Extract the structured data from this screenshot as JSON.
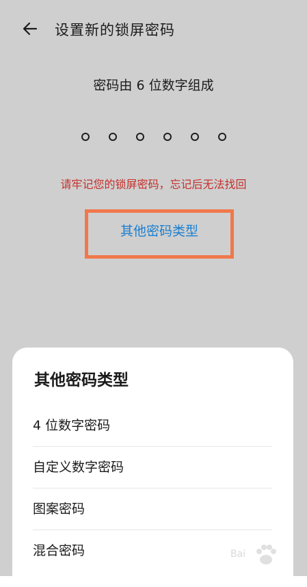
{
  "header": {
    "title": "设置新的锁屏密码",
    "back_icon": "arrow-left-icon"
  },
  "main": {
    "subtitle": "密码由 6 位数字组成",
    "pin_length": 6,
    "warning": "请牢记您的锁屏密码，忘记后无法找回",
    "other_types_link": "其他密码类型"
  },
  "sheet": {
    "title": "其他密码类型",
    "options": [
      {
        "label": "4 位数字密码"
      },
      {
        "label": "自定义数字密码"
      },
      {
        "label": "图案密码"
      },
      {
        "label": "混合密码"
      }
    ]
  },
  "watermark": {
    "text": "Bai"
  },
  "colors": {
    "background": "#cfcfcf",
    "warning": "#c4302b",
    "link": "#1a7fd1",
    "highlight_box": "#f0784a",
    "sheet": "#ffffff"
  }
}
